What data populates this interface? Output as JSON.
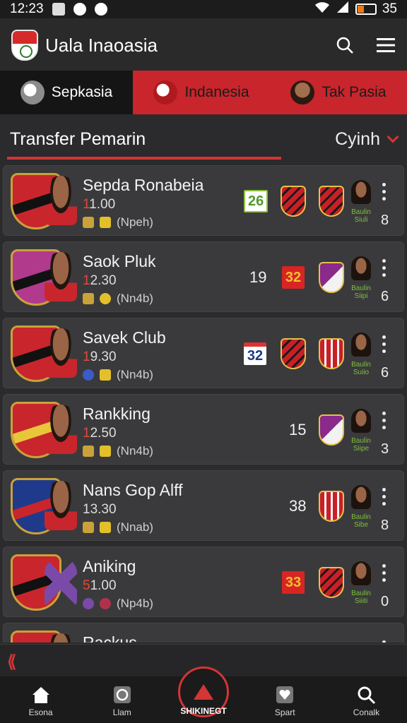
{
  "status": {
    "time": "12:23",
    "battery": "35",
    "battery_level": 0.35
  },
  "app": {
    "title": "Uala Inaoasia"
  },
  "tabs": [
    {
      "label": "Sepkasia"
    },
    {
      "label": "Indanesia"
    },
    {
      "label": "Tak Pasia"
    }
  ],
  "section": {
    "title": "Transfer Pemarin",
    "filter": "Cyinh"
  },
  "colors": {
    "accent": "#d43535",
    "card": "#3a3a3c",
    "tab_red": "#c9252c"
  },
  "players": [
    {
      "name": "Sepda Ronabeia",
      "price_lead": "1",
      "price_rest": "1.00",
      "meta": "(Npeh)",
      "score": "26",
      "score_style": "green",
      "label": "Baulin Siuli",
      "count": "8"
    },
    {
      "name": "Saok Pluk",
      "price_lead": "1",
      "price_rest": "2.30",
      "meta": "(Nn4b)",
      "extra": "19",
      "score": "32",
      "score_style": "red",
      "label": "Baulin Siipi",
      "count": "6"
    },
    {
      "name": "Savek Club",
      "price_lead": "1",
      "price_rest": "9.30",
      "meta": "(Nn4b)",
      "score": "32",
      "score_style": "cal",
      "label": "Baulin Suiio",
      "count": "6"
    },
    {
      "name": "Rankking",
      "price_lead": "1",
      "price_rest": "2.50",
      "meta": "(Nn4b)",
      "score": "15",
      "score_style": "plain",
      "label": "Baulin Siipe",
      "count": "3"
    },
    {
      "name": "Nans Gop Alff",
      "price_lead": "1",
      "price_rest": "3.30",
      "meta": "(Nnab)",
      "score": "38",
      "score_style": "plain",
      "label": "Baulin Sibe",
      "count": "8"
    },
    {
      "name": "Aniking",
      "price_lead": "5",
      "price_rest": "1.00",
      "meta": "(Np4b)",
      "score": "33",
      "score_style": "red",
      "label": "Baulin Siiiti",
      "count": "0"
    },
    {
      "name": "Rackus",
      "price_lead": "",
      "price_rest": "",
      "meta": "",
      "score": "",
      "score_style": "plain",
      "label": "",
      "count": ""
    }
  ],
  "nav": [
    {
      "label": "Esona",
      "icon": "home-icon"
    },
    {
      "label": "Llam",
      "icon": "timer-icon"
    },
    {
      "label": "SHIKINEGT",
      "icon": "warning-icon"
    },
    {
      "label": "Spart",
      "icon": "heart-icon"
    },
    {
      "label": "Conalk",
      "icon": "search-icon"
    }
  ]
}
